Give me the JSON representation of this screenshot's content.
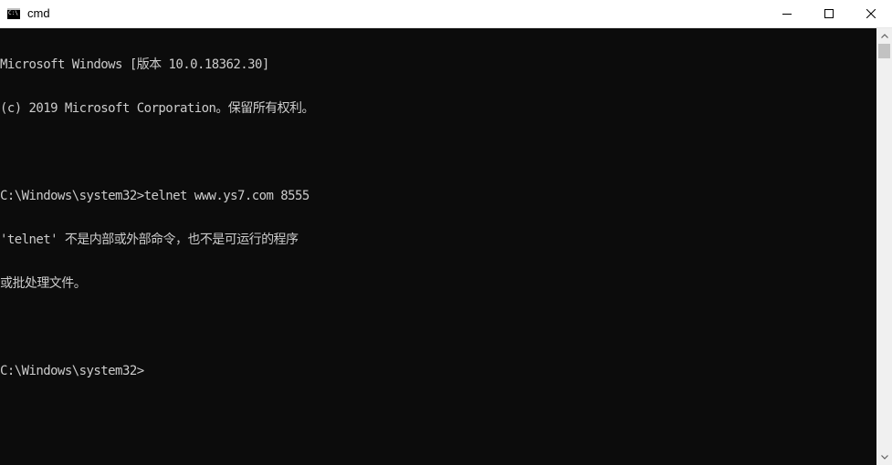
{
  "window": {
    "title": "cmd",
    "icon": "cmd-console-icon"
  },
  "controls": {
    "minimize_icon": "minimize-icon",
    "maximize_icon": "maximize-icon",
    "close_icon": "close-icon"
  },
  "console": {
    "lines": [
      "Microsoft Windows [版本 10.0.18362.30]",
      "(c) 2019 Microsoft Corporation。保留所有权利。",
      "",
      "C:\\Windows\\system32>telnet www.ys7.com 8555",
      "'telnet' 不是内部或外部命令，也不是可运行的程序",
      "或批处理文件。",
      "",
      "C:\\Windows\\system32>"
    ]
  },
  "colors": {
    "console_bg": "#0c0c0c",
    "console_fg": "#cccccc",
    "titlebar_bg": "#ffffff",
    "scrollbar_bg": "#f0f0f0",
    "scrollbar_thumb": "#c2c2c2"
  }
}
